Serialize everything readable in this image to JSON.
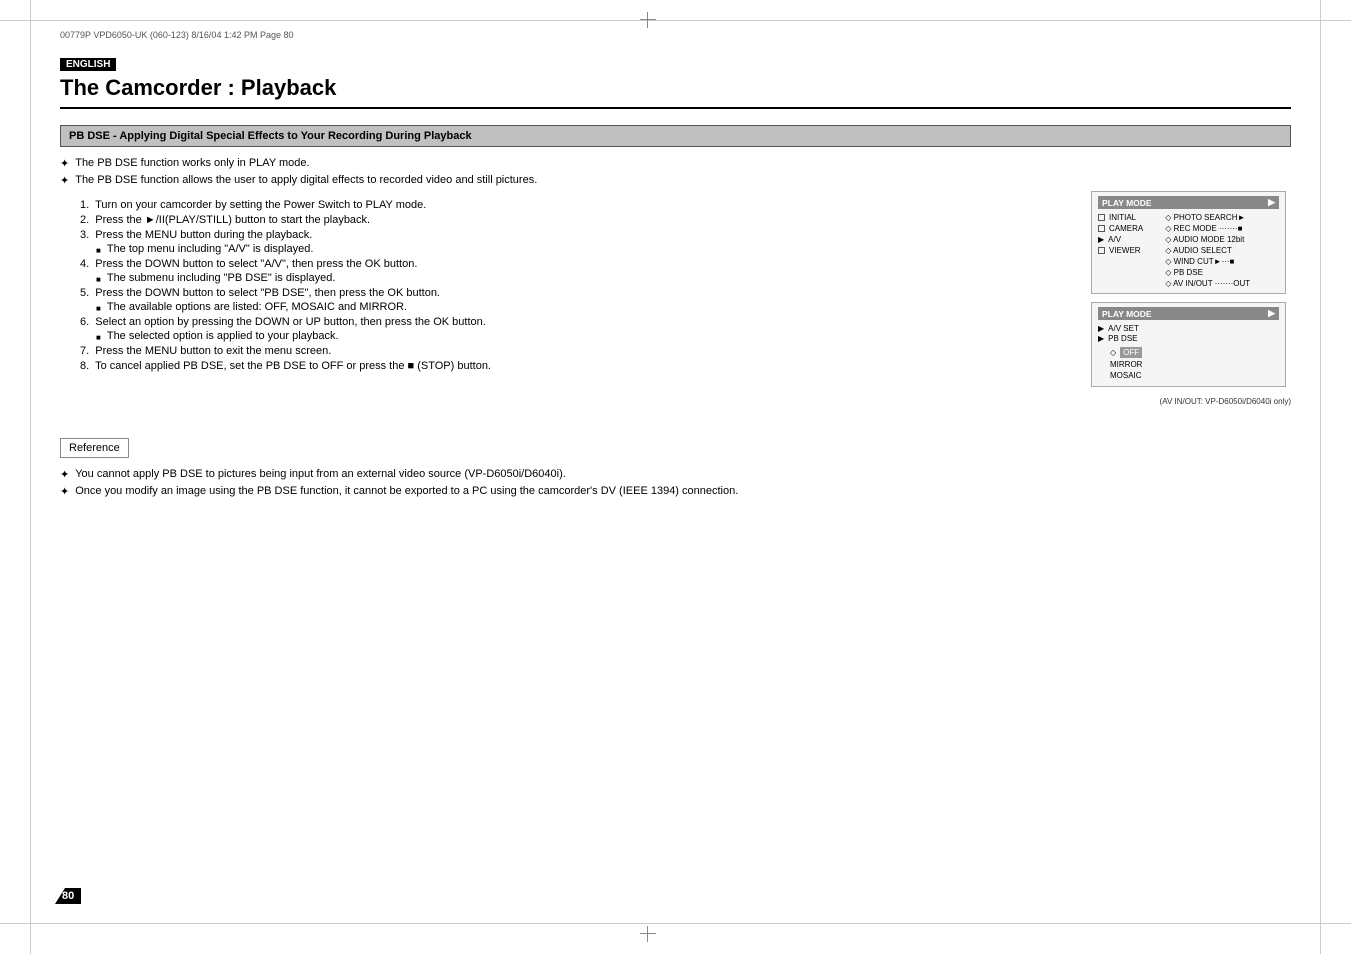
{
  "page": {
    "meta": "00779P VPD6050-UK (060-123)   8/16/04 1:42 PM   Page 80",
    "page_number": "80"
  },
  "header": {
    "badge": "ENGLISH",
    "title": "The Camcorder : Playback"
  },
  "section": {
    "title": "PB DSE - Applying Digital Special Effects to Your Recording During Playback"
  },
  "intro_bullets": [
    "The PB DSE function works only in PLAY mode.",
    "The PB DSE function allows the user to apply digital effects to recorded video and still pictures."
  ],
  "steps": [
    {
      "number": "1.",
      "text": "Turn on your camcorder by setting the Power Switch to PLAY mode."
    },
    {
      "number": "2.",
      "text": "Press the ►/II(PLAY/STILL) button to start the playback."
    },
    {
      "number": "3.",
      "text": "Press the MENU button during the playback.",
      "sub": "The top menu including \"A/V\" is displayed."
    },
    {
      "number": "4.",
      "text": "Press the DOWN button to select \"A/V\", then press the OK button.",
      "sub": "The submenu including \"PB DSE\" is displayed."
    },
    {
      "number": "5.",
      "text": "Press the DOWN button to select \"PB DSE\", then press the OK button.",
      "sub": "The available options are listed: OFF, MOSAIC and MIRROR."
    },
    {
      "number": "6.",
      "text": "Select an option by pressing the DOWN or UP button, then press the OK button.",
      "sub": "The selected option is applied to your playback."
    },
    {
      "number": "7.",
      "text": "Press the MENU button to exit the menu screen."
    },
    {
      "number": "8.",
      "text": "To cancel applied PB DSE, set the PB DSE to OFF or press the ■ (STOP) button."
    }
  ],
  "menu1": {
    "header": "PLAY MODE",
    "rows": [
      {
        "icon": "square",
        "label": "INITIAL"
      },
      {
        "icon": "square",
        "label": "CAMERA"
      },
      {
        "icon": "triangle",
        "label": "A/V"
      },
      {
        "icon": "square",
        "label": "VIEWER"
      }
    ],
    "subitems": [
      {
        "label": "◇ PHOTO SEARCH►"
      },
      {
        "label": "◇ REC MODE",
        "dots": "·······",
        "end": "■"
      },
      {
        "label": "◇ AUDIO MODE  12bit"
      },
      {
        "label": "◇ AUDIO SELECT"
      },
      {
        "label": "◇ WIND CUT►",
        "dots": "···",
        "end": "■"
      },
      {
        "label": "◇ PB DSE"
      },
      {
        "label": "◇ AV IN/OUT",
        "dots": "·······",
        "end": "OUT"
      }
    ]
  },
  "menu2": {
    "header": "PLAY MODE",
    "rows": [
      {
        "icon": "triangle",
        "label": "A/V SET"
      },
      {
        "icon": "triangle",
        "label": "PB DSE"
      }
    ],
    "options": [
      {
        "label": "◇",
        "value": "OFF",
        "selected": true
      },
      {
        "label": "",
        "value": "MIRROR"
      },
      {
        "label": "",
        "value": "MOSAIC"
      }
    ]
  },
  "menu_caption": "(AV IN/OUT: VP-D6050i/D6040i only)",
  "reference": {
    "label": "Reference",
    "bullets": [
      "You cannot apply PB DSE to pictures being input from an external video source (VP-D6050i/D6040i).",
      "Once you modify an image using the PB DSE function, it cannot be exported to a PC using the camcorder's DV (IEEE 1394) connection."
    ]
  }
}
